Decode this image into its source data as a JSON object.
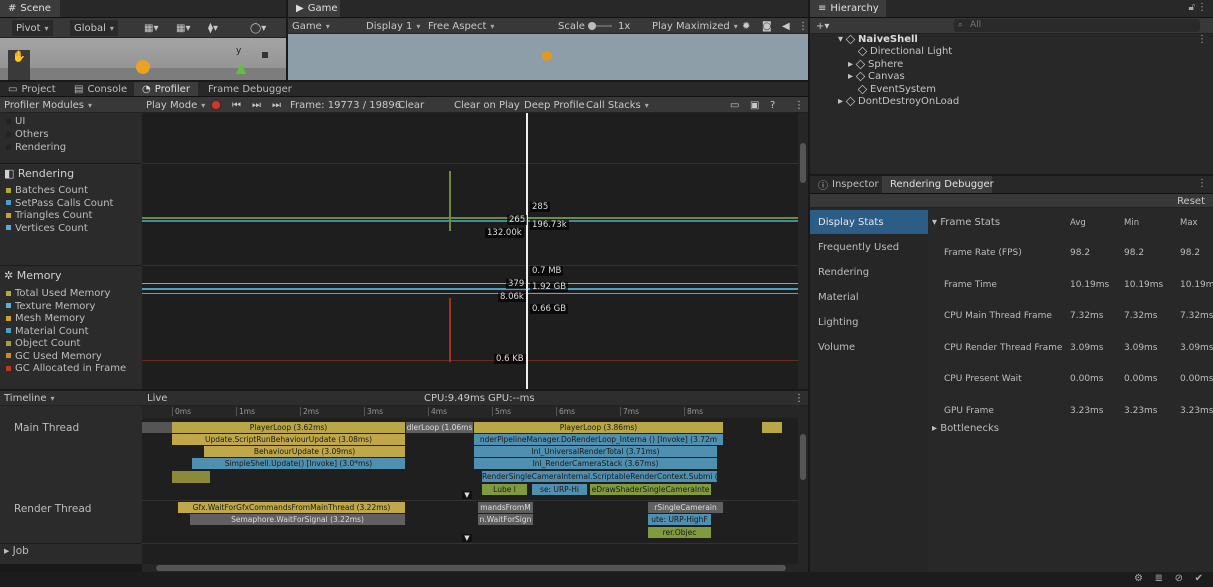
{
  "scene": {
    "tab": "Scene",
    "pivot": "Pivot",
    "global": "Global",
    "gizmo_y": "y"
  },
  "game": {
    "tab": "Game",
    "mode": "Game",
    "display": "Display 1",
    "aspect": "Free Aspect",
    "scale_label": "Scale",
    "scale_value": "1x",
    "play": "Play Maximized"
  },
  "hierarchy": {
    "tab": "Hierarchy",
    "search_placeholder": "All",
    "scene": "NaiveShell",
    "children": [
      "Directional Light",
      "Sphere",
      "Canvas",
      "EventSystem"
    ],
    "dontdestroy": "DontDestroyOnLoad"
  },
  "bottom_tabs": [
    "Project",
    "Console",
    "Profiler",
    "Frame Debugger"
  ],
  "profiler": {
    "modules": "Profiler Modules",
    "playmode": "Play Mode",
    "frame": "Frame: 19773 / 19896",
    "clear": "Clear",
    "clear_on_play": "Clear on Play",
    "deep": "Deep Profile",
    "callstacks": "Call Stacks",
    "top_items": [
      "UI",
      "Others",
      "Rendering"
    ],
    "rendering": {
      "title": "Rendering",
      "items": [
        "Batches Count",
        "SetPass Calls Count",
        "Triangles Count",
        "Vertices Count"
      ],
      "colors": [
        "#b0a93e",
        "#4a9cc9",
        "#c8a13a",
        "#60a8d8"
      ],
      "values": [
        "285",
        "265",
        "196.73k",
        "132.00k"
      ]
    },
    "memory": {
      "title": "Memory",
      "items": [
        "Total Used Memory",
        "Texture Memory",
        "Mesh Memory",
        "Material Count",
        "Object Count",
        "GC Used Memory",
        "GC Allocated in Frame"
      ],
      "colors": [
        "#b0a93e",
        "#5ab0d8",
        "#c8a13a",
        "#4aa0c0",
        "#a8a03a",
        "#c88a30",
        "#b83a20"
      ],
      "values": [
        "0.7 MB",
        "379",
        "1.92 GB",
        "8.06k",
        "0.66 GB",
        "0.6 KB"
      ]
    },
    "timeline": {
      "label": "Timeline",
      "live": "Live",
      "cpu": "CPU:9.49ms",
      "gpu": "GPU:--ms",
      "ruler": [
        "0ms",
        "1ms",
        "2ms",
        "3ms",
        "4ms",
        "5ms",
        "6ms",
        "7ms",
        "8ms"
      ],
      "threads": [
        "Main Thread",
        "Render Thread",
        "Job"
      ],
      "bars": [
        "PlayerLoop (3.62ms)",
        "Update.ScriptRunBehaviourUpdate (3.08ms)",
        "BehaviourUpdate (3.09ms)",
        "SimpleShell.Update() [Invoke] (3.0*ms)",
        "dlerLoop (1.06ms",
        "PlayerLoop (3.86ms)",
        "nderPipelineManager.DoRenderLoop_Interna () [Invoke] (3.72m",
        "Inl_UniversalRenderTotal (3.71ms)",
        "Inl_RenderCameraStack (3.67ms)",
        "RenderSingleCameraInternal.ScriptableRenderContext.Submi (2.6",
        "Lube l",
        "se: URP-Hi",
        "eDrawShaderSingleCameraInte",
        "Gfx.WaitForGfxCommandsFromMainThread (3.22ms)",
        "Semaphore.WaitForSignal (3.22ms)",
        "mandsFromM",
        "n.WaitForSign",
        "rSingleCamerain",
        "ute: URP-HighF",
        "rer.Objec"
      ]
    }
  },
  "inspector": {
    "tabs": [
      "Inspector",
      "Rendering Debugger"
    ],
    "reset": "Reset",
    "menu": [
      "Display Stats",
      "Frequently Used",
      "Rendering",
      "Material",
      "Lighting",
      "Volume"
    ],
    "section": "Frame Stats",
    "cols": [
      "Avg",
      "Min",
      "Max"
    ],
    "rows": [
      [
        "Frame Rate (FPS)",
        "98.2",
        "98.2",
        "98.2"
      ],
      [
        "Frame Time",
        "10.19ms",
        "10.19ms",
        "10.19ms"
      ],
      [
        "CPU Main Thread Frame",
        "7.32ms",
        "7.32ms",
        "7.32ms"
      ],
      [
        "CPU Render Thread Frame",
        "3.09ms",
        "3.09ms",
        "3.09ms"
      ],
      [
        "CPU Present Wait",
        "0.00ms",
        "0.00ms",
        "0.00ms"
      ],
      [
        "GPU Frame",
        "3.23ms",
        "3.23ms",
        "3.23ms"
      ]
    ],
    "bottlenecks": "Bottlenecks"
  }
}
